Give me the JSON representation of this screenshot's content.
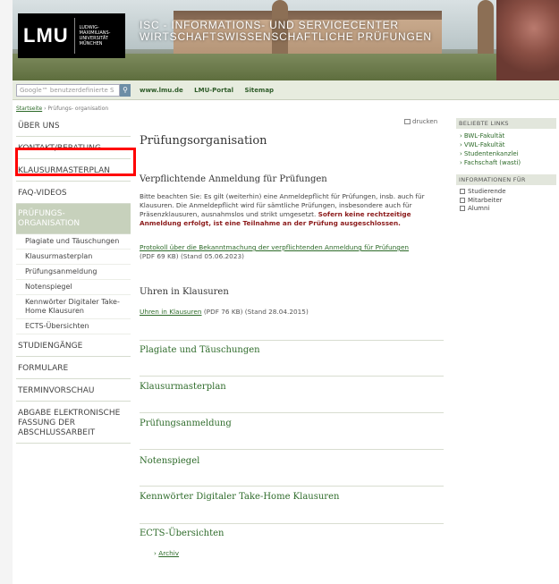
{
  "header": {
    "logo_text": "LMU",
    "logo_sub": [
      "LUDWIG-",
      "MAXIMILIANS-",
      "UNIVERSITÄT",
      "MÜNCHEN"
    ],
    "title_line1": "ISC - INFORMATIONS- UND SERVICECENTER",
    "title_line2": "WIRTSCHAFTSWISSENSCHAFTLICHE PRÜFUNGEN"
  },
  "search": {
    "placeholder": "Google™ benutzerdefinierte S"
  },
  "toplinks": [
    "www.lmu.de",
    "LMU-Portal",
    "Sitemap"
  ],
  "breadcrumb": {
    "home": "Startseite",
    "sep": " › ",
    "current": "Prüfungs- organisation"
  },
  "print_label": "drucken",
  "leftnav": {
    "items": [
      "ÜBER UNS",
      "KONTAKT/BERATUNG",
      "KLAUSURMASTERPLAN",
      "FAQ-VIDEOS"
    ],
    "active": "PRÜFUNGS-\nORGANISATION",
    "subitems": [
      "Plagiate und Täuschungen",
      "Klausurmasterplan",
      "Prüfungsanmeldung",
      "Notenspiegel",
      "Kennwörter Digitaler Take-Home Klausuren",
      "ECTS-Übersichten"
    ],
    "items_after": [
      "STUDIENGÄNGE",
      "FORMULARE",
      "TERMINVORSCHAU",
      "ABGABE ELEKTRONISCHE FASSUNG DER ABSCHLUSSARBEIT"
    ]
  },
  "main": {
    "title": "Prüfungsorganisation",
    "sec1_heading": "Verpflichtende Anmeldung für Prüfungen",
    "sec1_para": "Bitte beachten Sie: Es gilt (weiterhin) eine Anmeldepflicht für Prüfungen, insb. auch für Klausuren. Die Anmeldepflicht wird für sämtliche Prüfungen, insbesondere auch für Präsenzklausuren, ausnahmslos und strikt umgesetzt.",
    "sec1_bold": "Sofern keine rechtzeitige Anmeldung erfolgt, ist eine Teilnahme an der Prüfung ausgeschlossen.",
    "sec1_link": "Protokoll über die Bekanntmachung der verpflichtenden Anmeldung für Prüfungen",
    "sec1_meta": "(PDF 69 KB) (Stand 05.06.2023)",
    "sec2_heading": "Uhren in Klausuren",
    "sec2_link": "Uhren in Klausuren",
    "sec2_meta": "(PDF 76 KB) (Stand 28.04.2015)",
    "sections": [
      "Plagiate und Täuschungen",
      "Klausurmasterplan",
      "Prüfungsanmeldung",
      "Notenspiegel",
      "Kennwörter Digitaler Take-Home Klausuren",
      "ECTS-Übersichten"
    ],
    "archiv_link": "Archiv"
  },
  "sidebar": {
    "popular_heading": "BELIEBTE LINKS",
    "popular_links": [
      "BWL-Fakultät",
      "VWL-Fakultät",
      "Studentenkanzlei",
      "Fachschaft (wasti)"
    ],
    "info_heading": "INFORMATIONEN FÜR",
    "info_items": [
      "Studierende",
      "Mitarbeiter",
      "Alumni"
    ]
  }
}
